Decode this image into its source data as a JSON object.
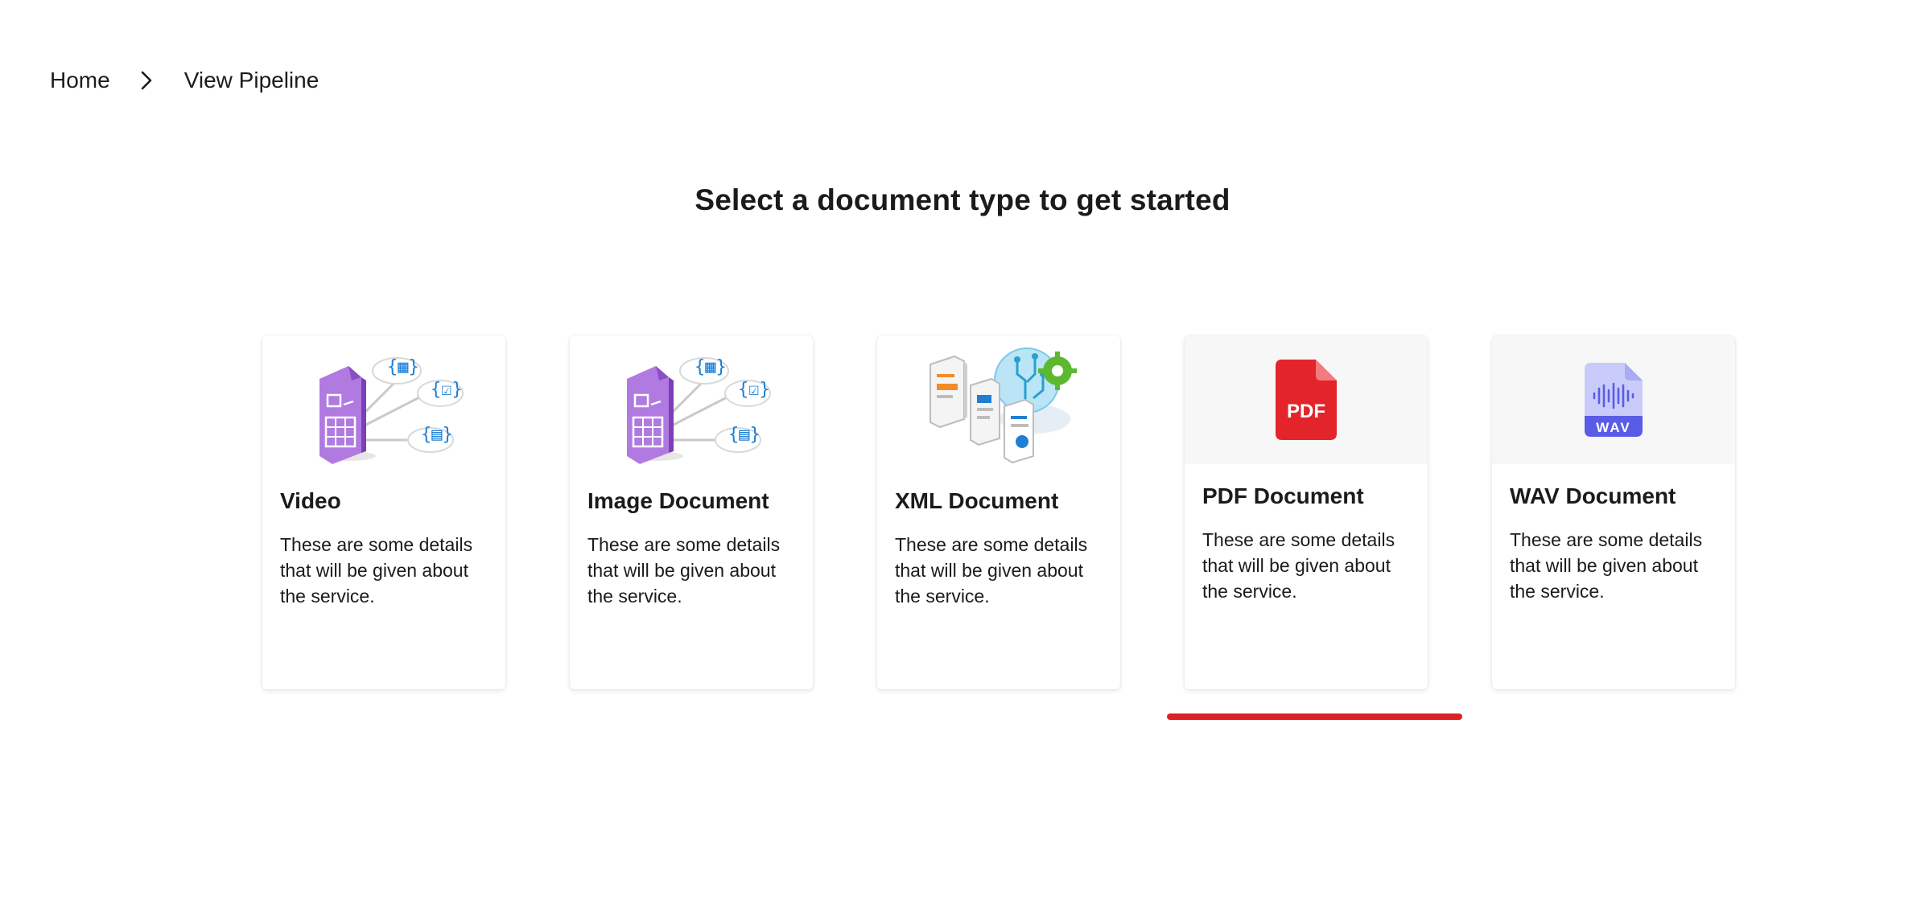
{
  "breadcrumb": {
    "items": [
      "Home",
      "View Pipeline"
    ],
    "separator_icon": "chevron-right-icon"
  },
  "page": {
    "title": "Select a document type to get started"
  },
  "cards": [
    {
      "title": "Video",
      "description": "These are some details that will be given about the service.",
      "icon": "structured-data-icon"
    },
    {
      "title": "Image Document",
      "description": "These are some details that will be given about the service.",
      "icon": "structured-data-icon"
    },
    {
      "title": "XML Document",
      "description": "These are some details that will be given about the service.",
      "icon": "document-processing-icon"
    },
    {
      "title": "PDF Document",
      "description": "These are some details that will be given about the service.",
      "icon": "pdf-file-icon",
      "icon_label": "PDF"
    },
    {
      "title": "WAV Document",
      "description": "These are some details that will be given about the service.",
      "icon": "wav-file-icon",
      "icon_label": "WAV"
    }
  ],
  "selection": {
    "selected_card": "PDF Document",
    "indicator_color": "#dd2026"
  },
  "colors": {
    "pdf_red": "#e3242b",
    "wav_blue": "#5a5ce6",
    "purple": "#9b5fd0",
    "accent_blue": "#1f7fd4"
  }
}
